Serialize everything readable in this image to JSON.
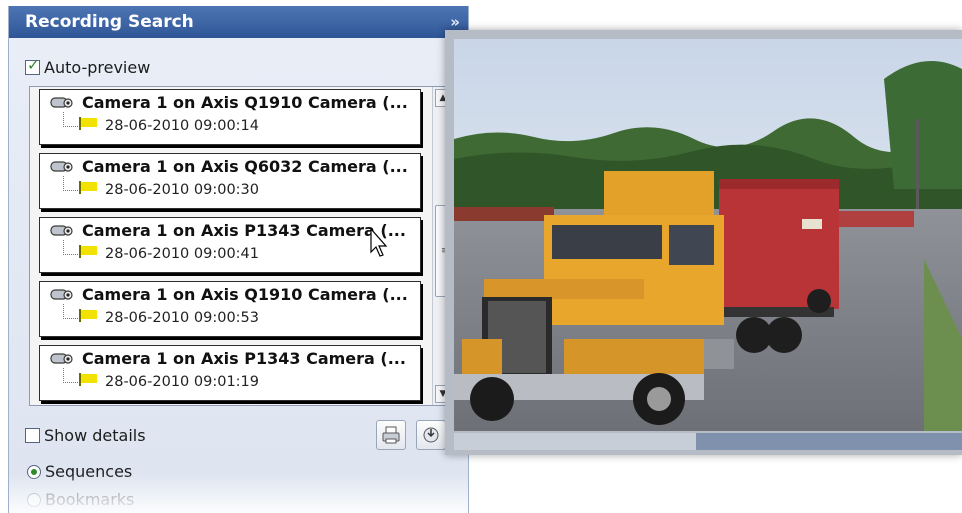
{
  "panel": {
    "title": "Recording Search",
    "collapse_icon": "double-chevron-down-icon",
    "auto_preview": {
      "label": "Auto-preview",
      "checked": true
    },
    "show_details": {
      "label": "Show details",
      "checked": false
    },
    "view_mode": {
      "options": [
        {
          "label": "Sequences",
          "selected": true
        },
        {
          "label": "Bookmarks",
          "selected": false
        }
      ]
    },
    "toolbar": {
      "print_icon": "print-icon",
      "export_icon": "export-icon"
    }
  },
  "recordings": [
    {
      "camera": "Camera 1 on Axis Q1910 Camera (...",
      "time": "28-06-2010 09:00:14"
    },
    {
      "camera": "Camera 1 on Axis Q6032 Camera (...",
      "time": "28-06-2010 09:00:30"
    },
    {
      "camera": "Camera 1 on Axis P1343 Camera (...",
      "time": "28-06-2010 09:00:41"
    },
    {
      "camera": "Camera 1 on Axis Q1910 Camera (...",
      "time": "28-06-2010 09:00:53"
    },
    {
      "camera": "Camera 1 on Axis P1343 Camera (...",
      "time": "28-06-2010 09:01:19"
    }
  ],
  "preview": {
    "image": "video-preview-truck",
    "progress": 0.52
  },
  "colors": {
    "header": "#3b63a5",
    "panel_bg": "#e4e9f3",
    "flag": "#f2e200",
    "accent_green": "#2c8a2c"
  }
}
